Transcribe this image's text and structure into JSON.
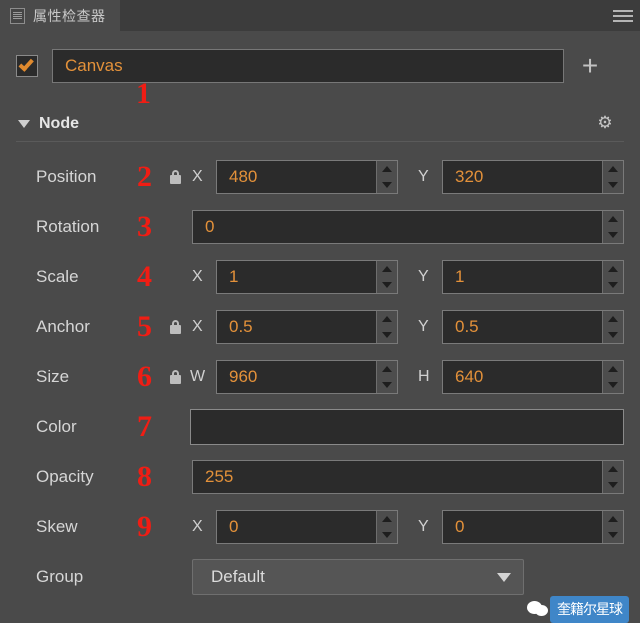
{
  "titlebar": {
    "tab_label": "属性检查器",
    "menu_icon": "hamburger-menu-icon",
    "panel_icon": "inspector-panel-icon"
  },
  "name_row": {
    "enabled": true,
    "node_name": "Canvas",
    "add_label": "+",
    "marker": "1"
  },
  "section": {
    "title": "Node",
    "expanded": true,
    "settings_icon": "gear-icon"
  },
  "colors": {
    "accent_value": "#e3913a",
    "marker_red": "#f01d14",
    "panel_bg": "#4a4a4a",
    "field_bg": "#2b2b2b",
    "swatch": "#ffffff",
    "watermark_blue": "#3f86c8"
  },
  "properties": [
    {
      "label": "Position",
      "marker": "2",
      "locked": true,
      "fields": [
        {
          "axis": "X",
          "value": "480"
        },
        {
          "axis": "Y",
          "value": "320"
        }
      ]
    },
    {
      "label": "Rotation",
      "marker": "3",
      "locked": false,
      "fields": [
        {
          "axis": "",
          "value": "0"
        }
      ]
    },
    {
      "label": "Scale",
      "marker": "4",
      "locked": false,
      "fields": [
        {
          "axis": "X",
          "value": "1"
        },
        {
          "axis": "Y",
          "value": "1"
        }
      ]
    },
    {
      "label": "Anchor",
      "marker": "5",
      "locked": true,
      "fields": [
        {
          "axis": "X",
          "value": "0.5"
        },
        {
          "axis": "Y",
          "value": "0.5"
        }
      ]
    },
    {
      "label": "Size",
      "marker": "6",
      "locked": true,
      "fields": [
        {
          "axis": "W",
          "value": "960"
        },
        {
          "axis": "H",
          "value": "640"
        }
      ]
    },
    {
      "label": "Color",
      "marker": "7",
      "locked": false,
      "swatch_color": "#ffffff"
    },
    {
      "label": "Opacity",
      "marker": "8",
      "locked": false,
      "fields": [
        {
          "axis": "",
          "value": "255"
        }
      ]
    },
    {
      "label": "Skew",
      "marker": "9",
      "locked": false,
      "fields": [
        {
          "axis": "X",
          "value": "0"
        },
        {
          "axis": "Y",
          "value": "0"
        }
      ]
    },
    {
      "label": "Group",
      "marker": "",
      "locked": false,
      "dropdown_value": "Default"
    }
  ],
  "watermark": {
    "icon": "wechat-icon",
    "text": "奎籍尔星球"
  }
}
